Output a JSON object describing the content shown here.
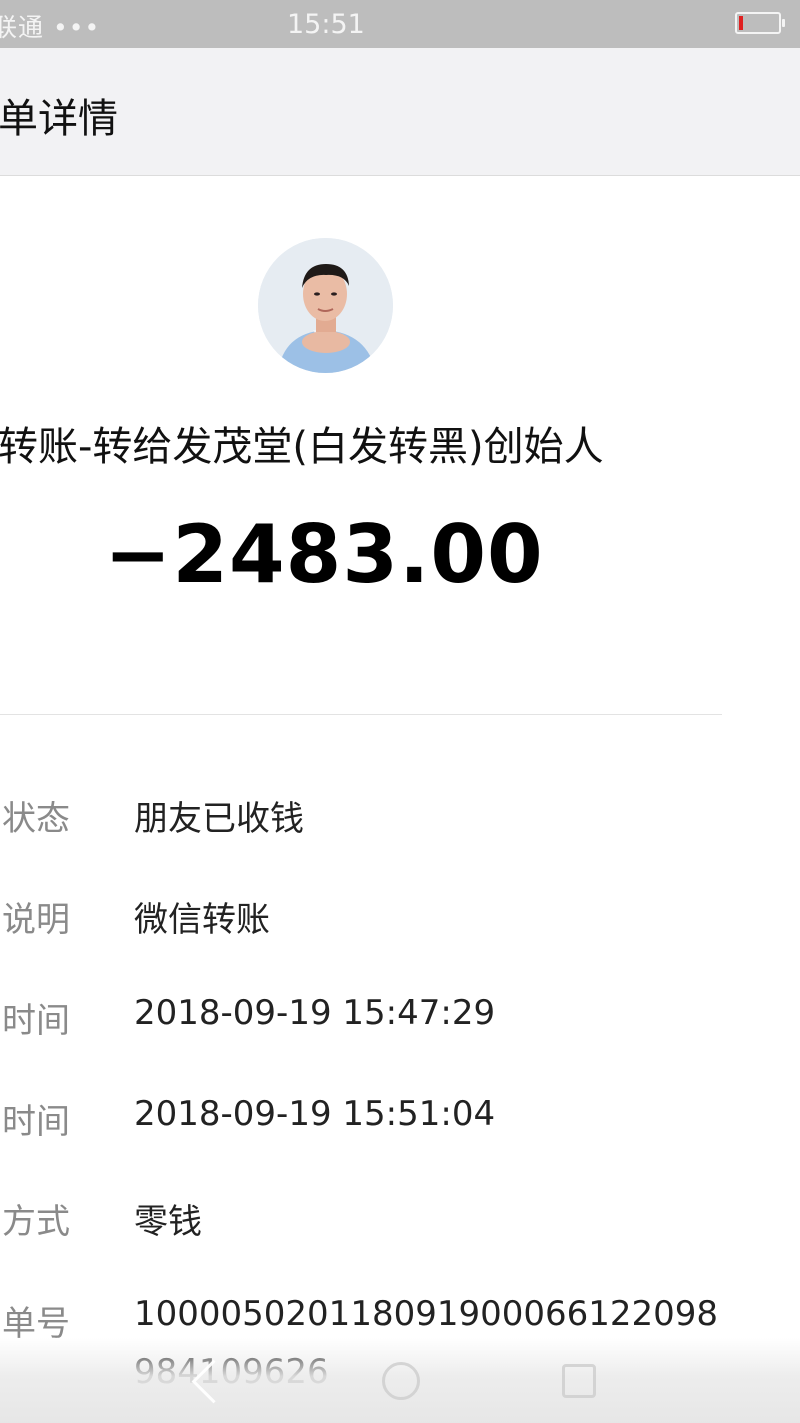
{
  "status_bar": {
    "carrier": "联通 •••",
    "time": "15:51",
    "battery_level": 0.1
  },
  "header": {
    "title": "单详情"
  },
  "transaction": {
    "payee": "转账-转给发茂堂(白发转黑)创始人",
    "amount": "−2483.00"
  },
  "details": [
    {
      "label": "状态",
      "value": "朋友已收钱"
    },
    {
      "label": "说明",
      "value": "微信转账"
    },
    {
      "label": "时间",
      "value": "2018-09-19 15:47:29"
    },
    {
      "label": "时间",
      "value": "2018-09-19 15:51:04"
    },
    {
      "label": "方式",
      "value": "零钱"
    },
    {
      "label": "单号",
      "value": "1000050201180919000661220989841​09626"
    }
  ],
  "colors": {
    "status_bar_bg": "#bdbdbd",
    "title_bar_bg": "#f2f2f4",
    "label_gray": "#8a8a8a",
    "battery_low": "#e02020"
  },
  "icons": {
    "nav_back": "back-chevron-icon",
    "nav_home": "circle-home-icon",
    "nav_recent": "square-recent-icon"
  }
}
